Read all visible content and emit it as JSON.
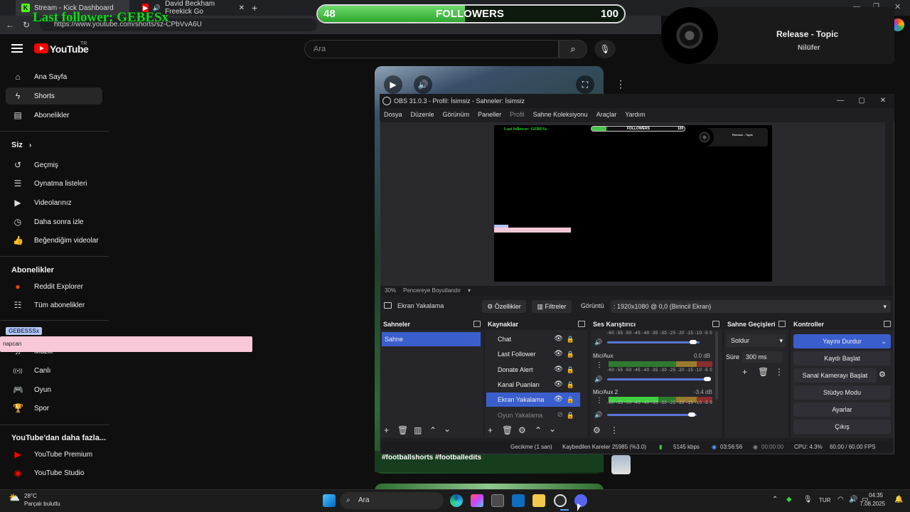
{
  "browser": {
    "tab1": "Stream - Kick Dashboard",
    "tab2": "David Beckham Freekick Go",
    "url": "https://www.youtube.com/shorts/sz-CPbVvA6U"
  },
  "overlay": {
    "last_follower": "Last follower: GEBESx",
    "followers_current": "48",
    "followers_label": "FOLLOWERS",
    "followers_goal": "100",
    "followers_progress": 0.48,
    "music_title": "Release - Topic",
    "music_artist": "Nilüfer",
    "pink_badge": "GEBESSSx",
    "pink_text": "napcan"
  },
  "youtube": {
    "logo_text": "YouTube",
    "logo_sup": "TR",
    "search_placeholder": "Ara",
    "nav": [
      {
        "label": "Ana Sayfa",
        "icon": "⌂"
      },
      {
        "label": "Shorts",
        "icon": "ϟ"
      },
      {
        "label": "Abonelikler",
        "icon": "▤"
      }
    ],
    "you_title": "Siz",
    "you_items": [
      {
        "label": "Geçmiş",
        "icon": "↺"
      },
      {
        "label": "Oynatma listeleri",
        "icon": "☰"
      },
      {
        "label": "Videolarınız",
        "icon": "▶"
      },
      {
        "label": "Daha sonra izle",
        "icon": "◷"
      },
      {
        "label": "Beğendiğim videolar",
        "icon": "👍"
      }
    ],
    "subs_title": "Abonelikler",
    "subs_items": [
      {
        "label": "Reddit Explorer",
        "icon": "●"
      },
      {
        "label": "Tüm abonelikler",
        "icon": "☷"
      }
    ],
    "explore_items": [
      {
        "label": "Müzik",
        "icon": "♫"
      },
      {
        "label": "Canlı",
        "icon": "((•))"
      },
      {
        "label": "Oyun",
        "icon": "🎮"
      },
      {
        "label": "Spor",
        "icon": "🏆"
      }
    ],
    "more_title": "YouTube'dan daha fazla...",
    "more_items": [
      {
        "label": "YouTube Premium",
        "icon": "▶"
      },
      {
        "label": "YouTube Studio",
        "icon": "◉"
      }
    ],
    "short_caption": "#footballshorts #footballedits"
  },
  "obs": {
    "title": "OBS 31.0.3 - Profil: İsimsiz - Sahneler: İsimsiz",
    "menu": [
      "Dosya",
      "Düzenle",
      "Görünüm",
      "Paneller",
      "Profil",
      "Sahne Koleksiyonu",
      "Araçlar",
      "Yardım"
    ],
    "zoom": "30%",
    "zoom_mode": "Pencereye Boyutlandır",
    "mini_last": "Last follower: GEBESx",
    "mini_followers": "FOLLOWERS",
    "mini_goal": "100",
    "mini_music_title": "Release - Topic",
    "source_name": "Ekran Yakalama",
    "props_btn": "Özellikler",
    "filters_btn": "Filtreler",
    "display_label": "Görüntü",
    "display_value": ": 1920x1080 @ 0,0 (Birincil Ekran)",
    "docks": {
      "scenes": "Sahneler",
      "sources": "Kaynaklar",
      "mixer": "Ses Karıştırıcı",
      "transitions": "Sahne Geçişleri",
      "controls": "Kontroller"
    },
    "scenes": [
      "Sahne"
    ],
    "sources": [
      "Chat",
      "Last Follower",
      "Donate Alert",
      "Kanal Puanları",
      "Ekran Yakalama",
      "Oyun Yakalama"
    ],
    "mixer": {
      "scale": "-60 -55 -50 -45 -40 -35 -30 -25 -20 -15 -10 -5 0",
      "ch1_label": "Mic/Aux",
      "ch1_db": "0.0 dB",
      "ch2_label": "Mic/Aux 2",
      "ch2_db": "-3.4 dB"
    },
    "transition": "Soldur",
    "duration_label": "Süre",
    "duration": "300 ms",
    "controls": [
      "Yayını Durdur",
      "Kaydı Başlat",
      "Sanal Kamerayı Başlat",
      "Stüdyo Modu",
      "Ayarlar",
      "Çıkış"
    ],
    "status": {
      "delay": "Gecikme (1 san)",
      "dropped": "Kaybedilen Kareler 25985 (%3.0)",
      "bitrate": "5145 kbps",
      "live_time": "03:56:56",
      "rec_time": "00:00:00",
      "cpu": "CPU: 4.3%",
      "fps": "60.00 / 60.00 FPS"
    }
  },
  "taskbar": {
    "weather_temp": "28°C",
    "weather_desc": "Parçalı bulutlu",
    "search": "Ara",
    "lang": "TUR",
    "time": "04:35",
    "date": "7.08.2025"
  }
}
